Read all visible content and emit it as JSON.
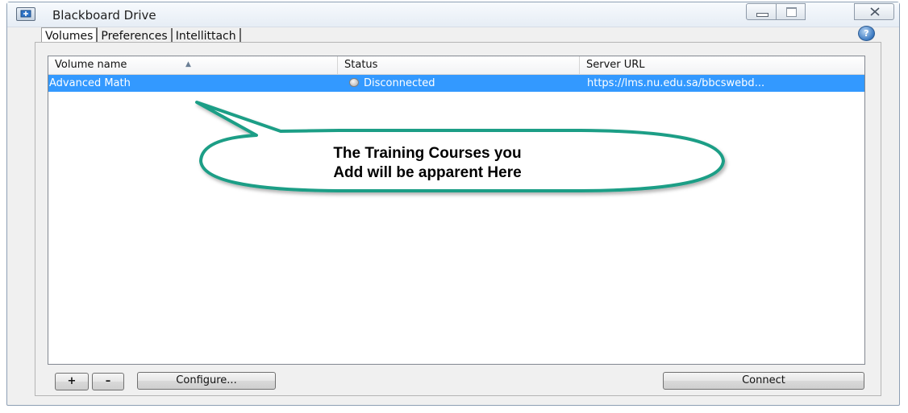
{
  "window": {
    "title": "Blackboard Drive",
    "controls": [
      "minimize",
      "maximize",
      "close"
    ]
  },
  "tabs": [
    {
      "label": "Volumes",
      "active": true
    },
    {
      "label": "Preferences",
      "active": false
    },
    {
      "label": "Intellittach",
      "active": false
    }
  ],
  "table": {
    "columns": [
      "Volume name",
      "Status",
      "Server URL"
    ],
    "sorted_column": "Volume name",
    "rows": [
      {
        "name": "Advanced Math",
        "status": "Disconnected",
        "url": "https://lms.nu.edu.sa/bbcswebd...",
        "selected": true
      }
    ]
  },
  "callout": {
    "line1": "The Training Courses you",
    "line2": "Add will be apparent Here"
  },
  "buttons": {
    "add": "+",
    "remove": "–",
    "configure": "Configure...",
    "connect": "Connect"
  },
  "icons": {
    "app": "drive-icon",
    "help": "help-icon",
    "status": "status-dot-icon"
  },
  "colors": {
    "selection": "#3399ff",
    "callout_fill": "#ffffff",
    "callout_border": "#1e9e86"
  }
}
